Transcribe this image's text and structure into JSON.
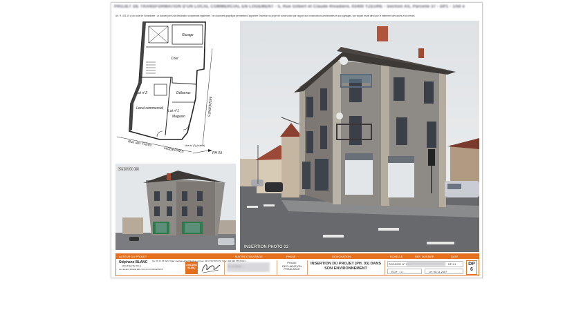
{
  "sheet": {
    "title": "PROJET DE TRANSFORMATION D'UN LOCAL COMMERCIAL EN LOGEMENT - 5, Rue Gilbert et Claude Rivadiere, 03400 YZEURE - Section AS, Parcelle 37 - DP1 - 1/50 e",
    "subtitle": "Art. R. 431-10 c) du code de l'urbanisme : un dossier joint à la déclaration comprenant également : un document graphique permettant d'apprécier l'insertion du projet de construction par rapport aux constructions avoisinantes et aux paysages, son impact visuel ainsi que le traitement des accès et du terrain."
  },
  "plan": {
    "labels": {
      "garage": "Garage",
      "cour": "Cour",
      "lot2": "Lot n°2",
      "lot1": "Lot n°1",
      "local": "Local commercial",
      "magasin": "Magasin",
      "debarras": "Débarras",
      "street_left": "Rue des Frères",
      "street_bottom": "MODERNES",
      "street_right": "MODERNES",
      "photo_ref": "PH 03",
      "note": "Vue du (?) (mairie)"
    }
  },
  "photos": {
    "small_label": "PHOTO 03",
    "main_label": "INSERTION PHOTO 03"
  },
  "title_block": {
    "headers": {
      "author": "AUTEUR DU PROJET",
      "owner": "MAITRE D'OUVRAGE",
      "phase": "PHASE",
      "designation": "DESIGNATION",
      "scale": "ECHELLE",
      "ref": "REF. DOSSIER",
      "date": "DATE"
    },
    "author_name": "Stéphane BLANC",
    "author_role": "ARCHITECTE DPLG",
    "author_extra": "Les ateliers Estelle Ellis 04 240 COURCEMONT",
    "contact": "Tel: 06 71 78 39 67 Mail: stephane@architectes.org Fax: 04 97 55 55 55 N° Siret: 494 848 785 00013",
    "badge": "ATELIERS BLANC",
    "owner": "M. et Mme ...",
    "phase": "PHASE DECLARATION PREALABLE",
    "designation": "INSERTION DU PROJET (PH. 03) DANS SON ENVIRONNEMENT",
    "dossier_label": "DOSSIER N° 2007",
    "dossier_code": "DP-01",
    "scale": "ECH. : 1/...",
    "date": "Le: 05.11.2007",
    "dp_line1": "DP",
    "dp_line2": "6"
  },
  "colors": {
    "accent": "#e4701e",
    "stone": "#8d8a86",
    "roof": "#3e3a38"
  }
}
